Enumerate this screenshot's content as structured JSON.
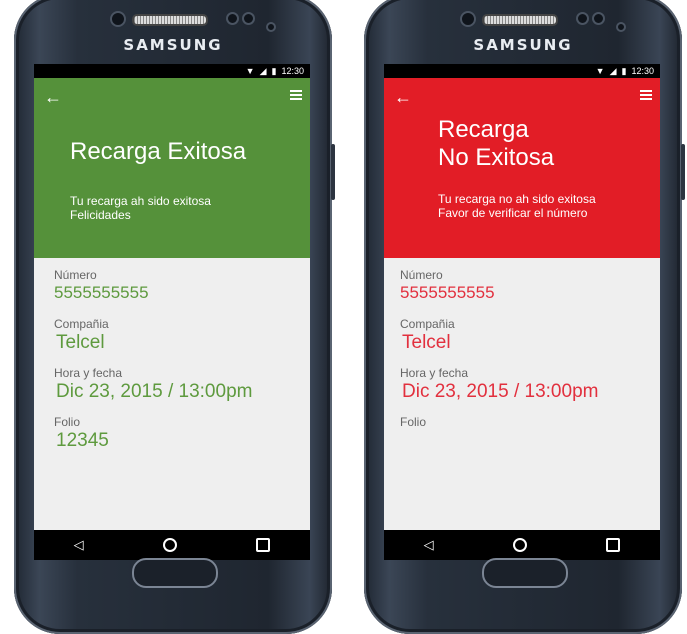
{
  "brand": "SAMSUNG",
  "status": {
    "time": "12:30"
  },
  "phones": [
    {
      "theme": {
        "header_bg": "#55913a",
        "accent": "#5e9a3e"
      },
      "title_line1": "Recarga Exitosa",
      "title_line2": "",
      "subtitle_line1": "Tu recarga ah sido exitosa",
      "subtitle_line2": "Felicidades",
      "fields": [
        {
          "label": "Número",
          "value": "5555555555"
        },
        {
          "label": "Compañia",
          "value": "Telcel"
        },
        {
          "label": "Hora y fecha",
          "value": "Dic 23, 2015 / 13:00pm"
        },
        {
          "label": "Folio",
          "value": "12345"
        }
      ]
    },
    {
      "theme": {
        "header_bg": "#e21d26",
        "accent": "#e2303e"
      },
      "title_line1": "Recarga",
      "title_line2": "No Exitosa",
      "subtitle_line1": "Tu recarga no ah sido exitosa",
      "subtitle_line2": "Favor de verificar el número",
      "fields": [
        {
          "label": "Número",
          "value": "5555555555"
        },
        {
          "label": "Compañia",
          "value": "Telcel"
        },
        {
          "label": "Hora y fecha",
          "value": "Dic 23, 2015 / 13:00pm"
        },
        {
          "label": "Folio",
          "value": ""
        }
      ]
    }
  ]
}
